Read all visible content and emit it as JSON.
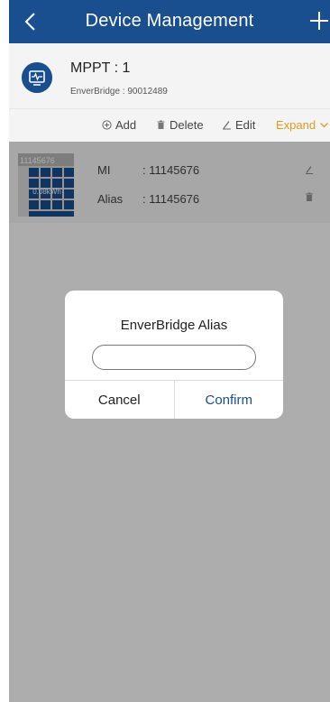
{
  "header": {
    "title": "Device Management",
    "back_icon": "chevron-left-icon",
    "add_icon": "plus-icon"
  },
  "device": {
    "name": "MPPT : 1",
    "subtitle": "EnverBridge : 90012489",
    "icon": "monitor-icon"
  },
  "actions": {
    "add_label": "Add",
    "delete_label": "Delete",
    "edit_label": "Edit",
    "expand_label": "Expand"
  },
  "panel": {
    "thumb_id": "11145676",
    "thumb_energy": "0.08kWh",
    "mi_label": "MI",
    "mi_value": ": 11145676",
    "alias_label": "Alias",
    "alias_value": ": 11145676"
  },
  "dialog": {
    "title": "EnverBridge Alias",
    "input_value": "",
    "input_placeholder": "",
    "cancel_label": "Cancel",
    "confirm_label": "Confirm"
  },
  "colors": {
    "header_bg": "#1a4f8f",
    "accent_expand": "#e39b1d",
    "confirm_text": "#1a4f8f"
  }
}
